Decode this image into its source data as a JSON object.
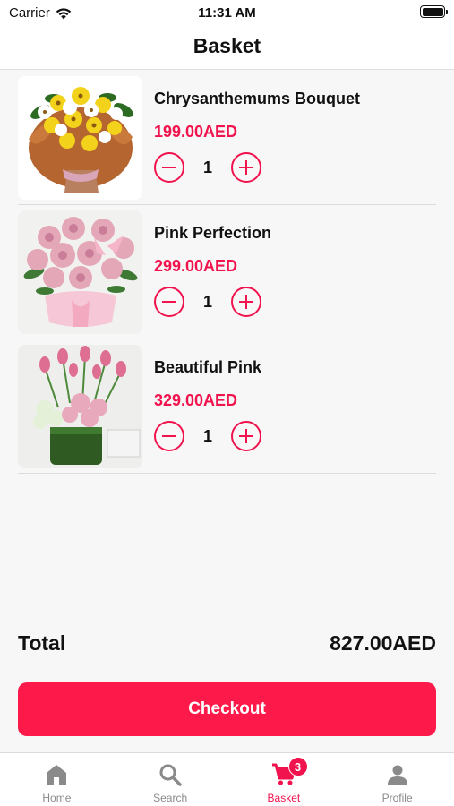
{
  "status_bar": {
    "carrier": "Carrier",
    "time": "11:31 AM"
  },
  "header": {
    "title": "Basket"
  },
  "basket": {
    "items": [
      {
        "name": "Chrysanthemums Bouquet",
        "price": "199.00AED",
        "quantity": "1",
        "image_icon": "chrysanthemum-bouquet-image"
      },
      {
        "name": "Pink Perfection",
        "price": "299.00AED",
        "quantity": "1",
        "image_icon": "pink-bouquet-image"
      },
      {
        "name": "Beautiful Pink",
        "price": "329.00AED",
        "quantity": "1",
        "image_icon": "pink-tulip-vase-image"
      }
    ]
  },
  "summary": {
    "total_label": "Total",
    "total_value": "827.00AED"
  },
  "checkout": {
    "label": "Checkout"
  },
  "tab_bar": {
    "tabs": [
      {
        "label": "Home",
        "icon": "home-icon",
        "active": false
      },
      {
        "label": "Search",
        "icon": "search-icon",
        "active": false
      },
      {
        "label": "Basket",
        "icon": "cart-icon",
        "active": true,
        "badge": "3"
      },
      {
        "label": "Profile",
        "icon": "person-icon",
        "active": false
      }
    ]
  },
  "colors": {
    "accent": "#f0134d",
    "checkout_bg": "#fd1a4a",
    "background": "#f7f7f7",
    "inactive_tab": "#8a8a8a"
  }
}
